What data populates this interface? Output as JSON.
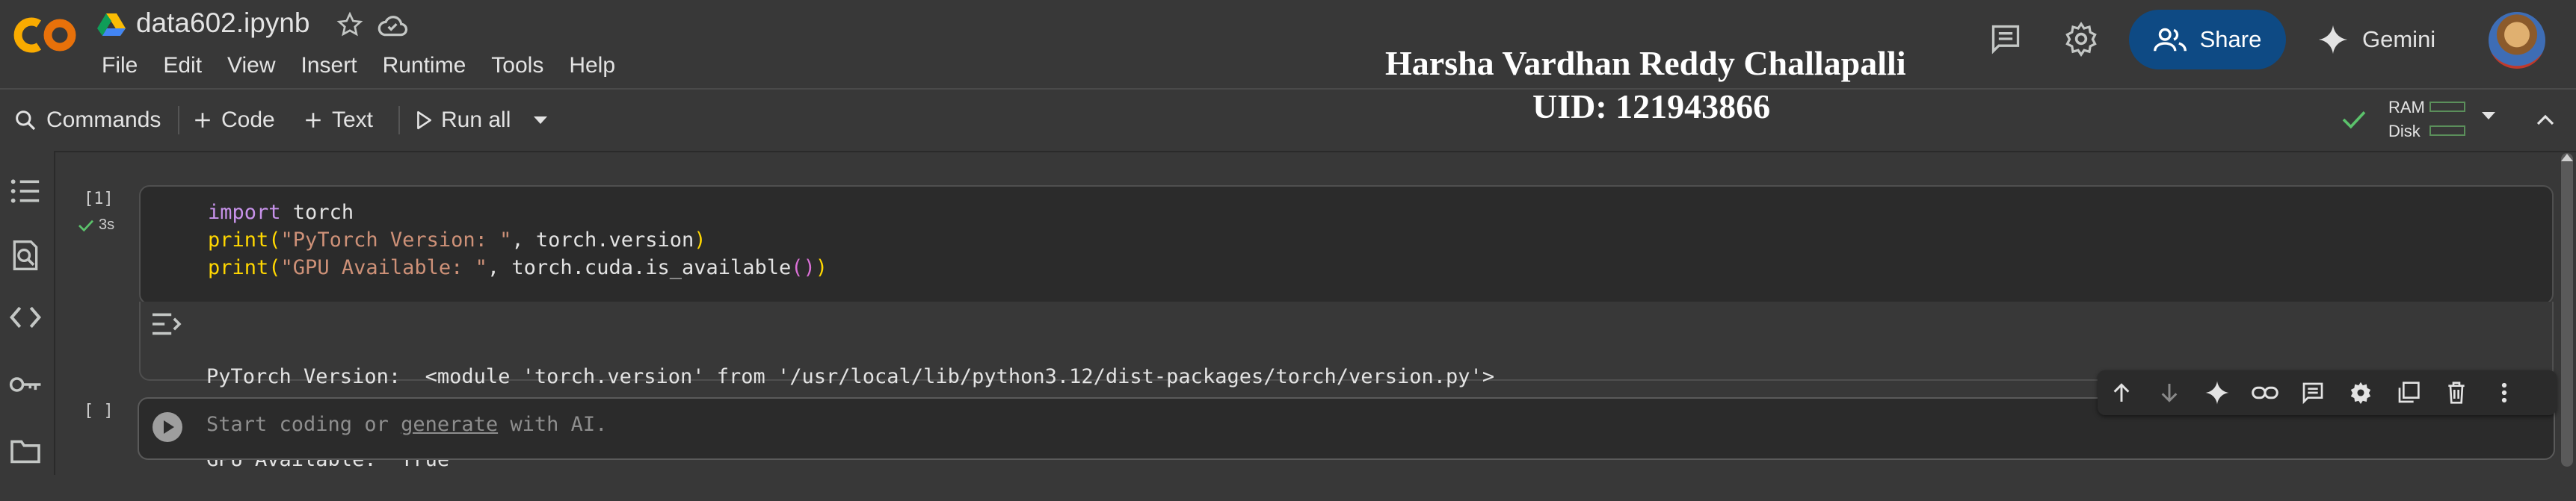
{
  "app": {
    "title": "data602.ipynb",
    "brand_colors": {
      "logo_orange": "#f9ab00",
      "logo_dark_orange": "#e8710a",
      "share_blue": "#0e4a84"
    }
  },
  "menu": [
    "File",
    "Edit",
    "View",
    "Insert",
    "Runtime",
    "Tools",
    "Help"
  ],
  "overlay": {
    "name": "Harsha Vardhan Reddy Challapalli",
    "uid": "UID: 121943866"
  },
  "header_right": {
    "share_label": "Share",
    "gemini_label": "Gemini"
  },
  "toolbar": {
    "commands_label": "Commands",
    "code_label": "Code",
    "text_label": "Text",
    "run_all_label": "Run all",
    "ram_label": "RAM",
    "disk_label": "Disk"
  },
  "sidebar": {
    "items": [
      "table-of-contents-icon",
      "find-replace-icon",
      "code-snippets-icon",
      "secrets-key-icon",
      "files-folder-icon"
    ]
  },
  "cells": [
    {
      "execution_count": "[1]",
      "duration": "3s",
      "code_lines": [
        "import torch",
        "print(\"PyTorch Version: \", torch.version)",
        "print(\"GPU Available: \", torch.cuda.is_available())"
      ],
      "output_lines": [
        "PyTorch Version:  <module 'torch.version' from '/usr/local/lib/python3.12/dist-packages/torch/version.py'>",
        "GPU Available:  True"
      ]
    },
    {
      "execution_count": "[ ]",
      "placeholder_prefix": "Start coding or ",
      "placeholder_link": "generate",
      "placeholder_suffix": " with AI."
    }
  ],
  "cell_toolbar": [
    "move-up-icon",
    "move-down-icon",
    "gemini-sparkle-icon",
    "link-icon",
    "comment-icon",
    "settings-icon",
    "mirror-cell-icon",
    "delete-icon",
    "more-options-icon"
  ]
}
